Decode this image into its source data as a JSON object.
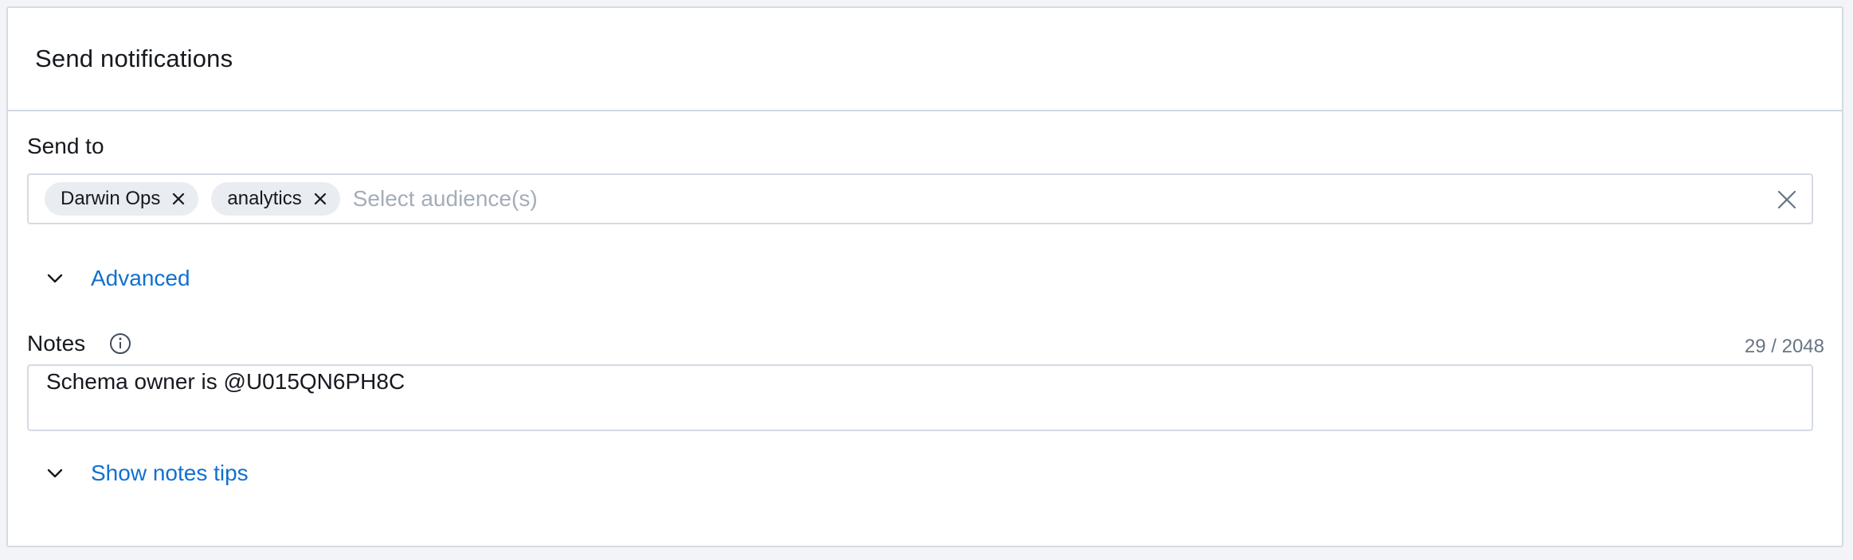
{
  "panel": {
    "title": "Send notifications"
  },
  "send_to": {
    "label": "Send to",
    "tokens": [
      {
        "label": "Darwin Ops"
      },
      {
        "label": "analytics"
      }
    ],
    "placeholder": "Select audience(s)"
  },
  "advanced": {
    "label": "Advanced"
  },
  "notes": {
    "label": "Notes",
    "counter": "29 / 2048",
    "value": "Schema owner is @U015QN6PH8C"
  },
  "tips": {
    "label": "Show notes tips"
  },
  "colors": {
    "link": "#1170cf",
    "border": "#d5dbe3",
    "token_bg": "#e9edf2"
  }
}
